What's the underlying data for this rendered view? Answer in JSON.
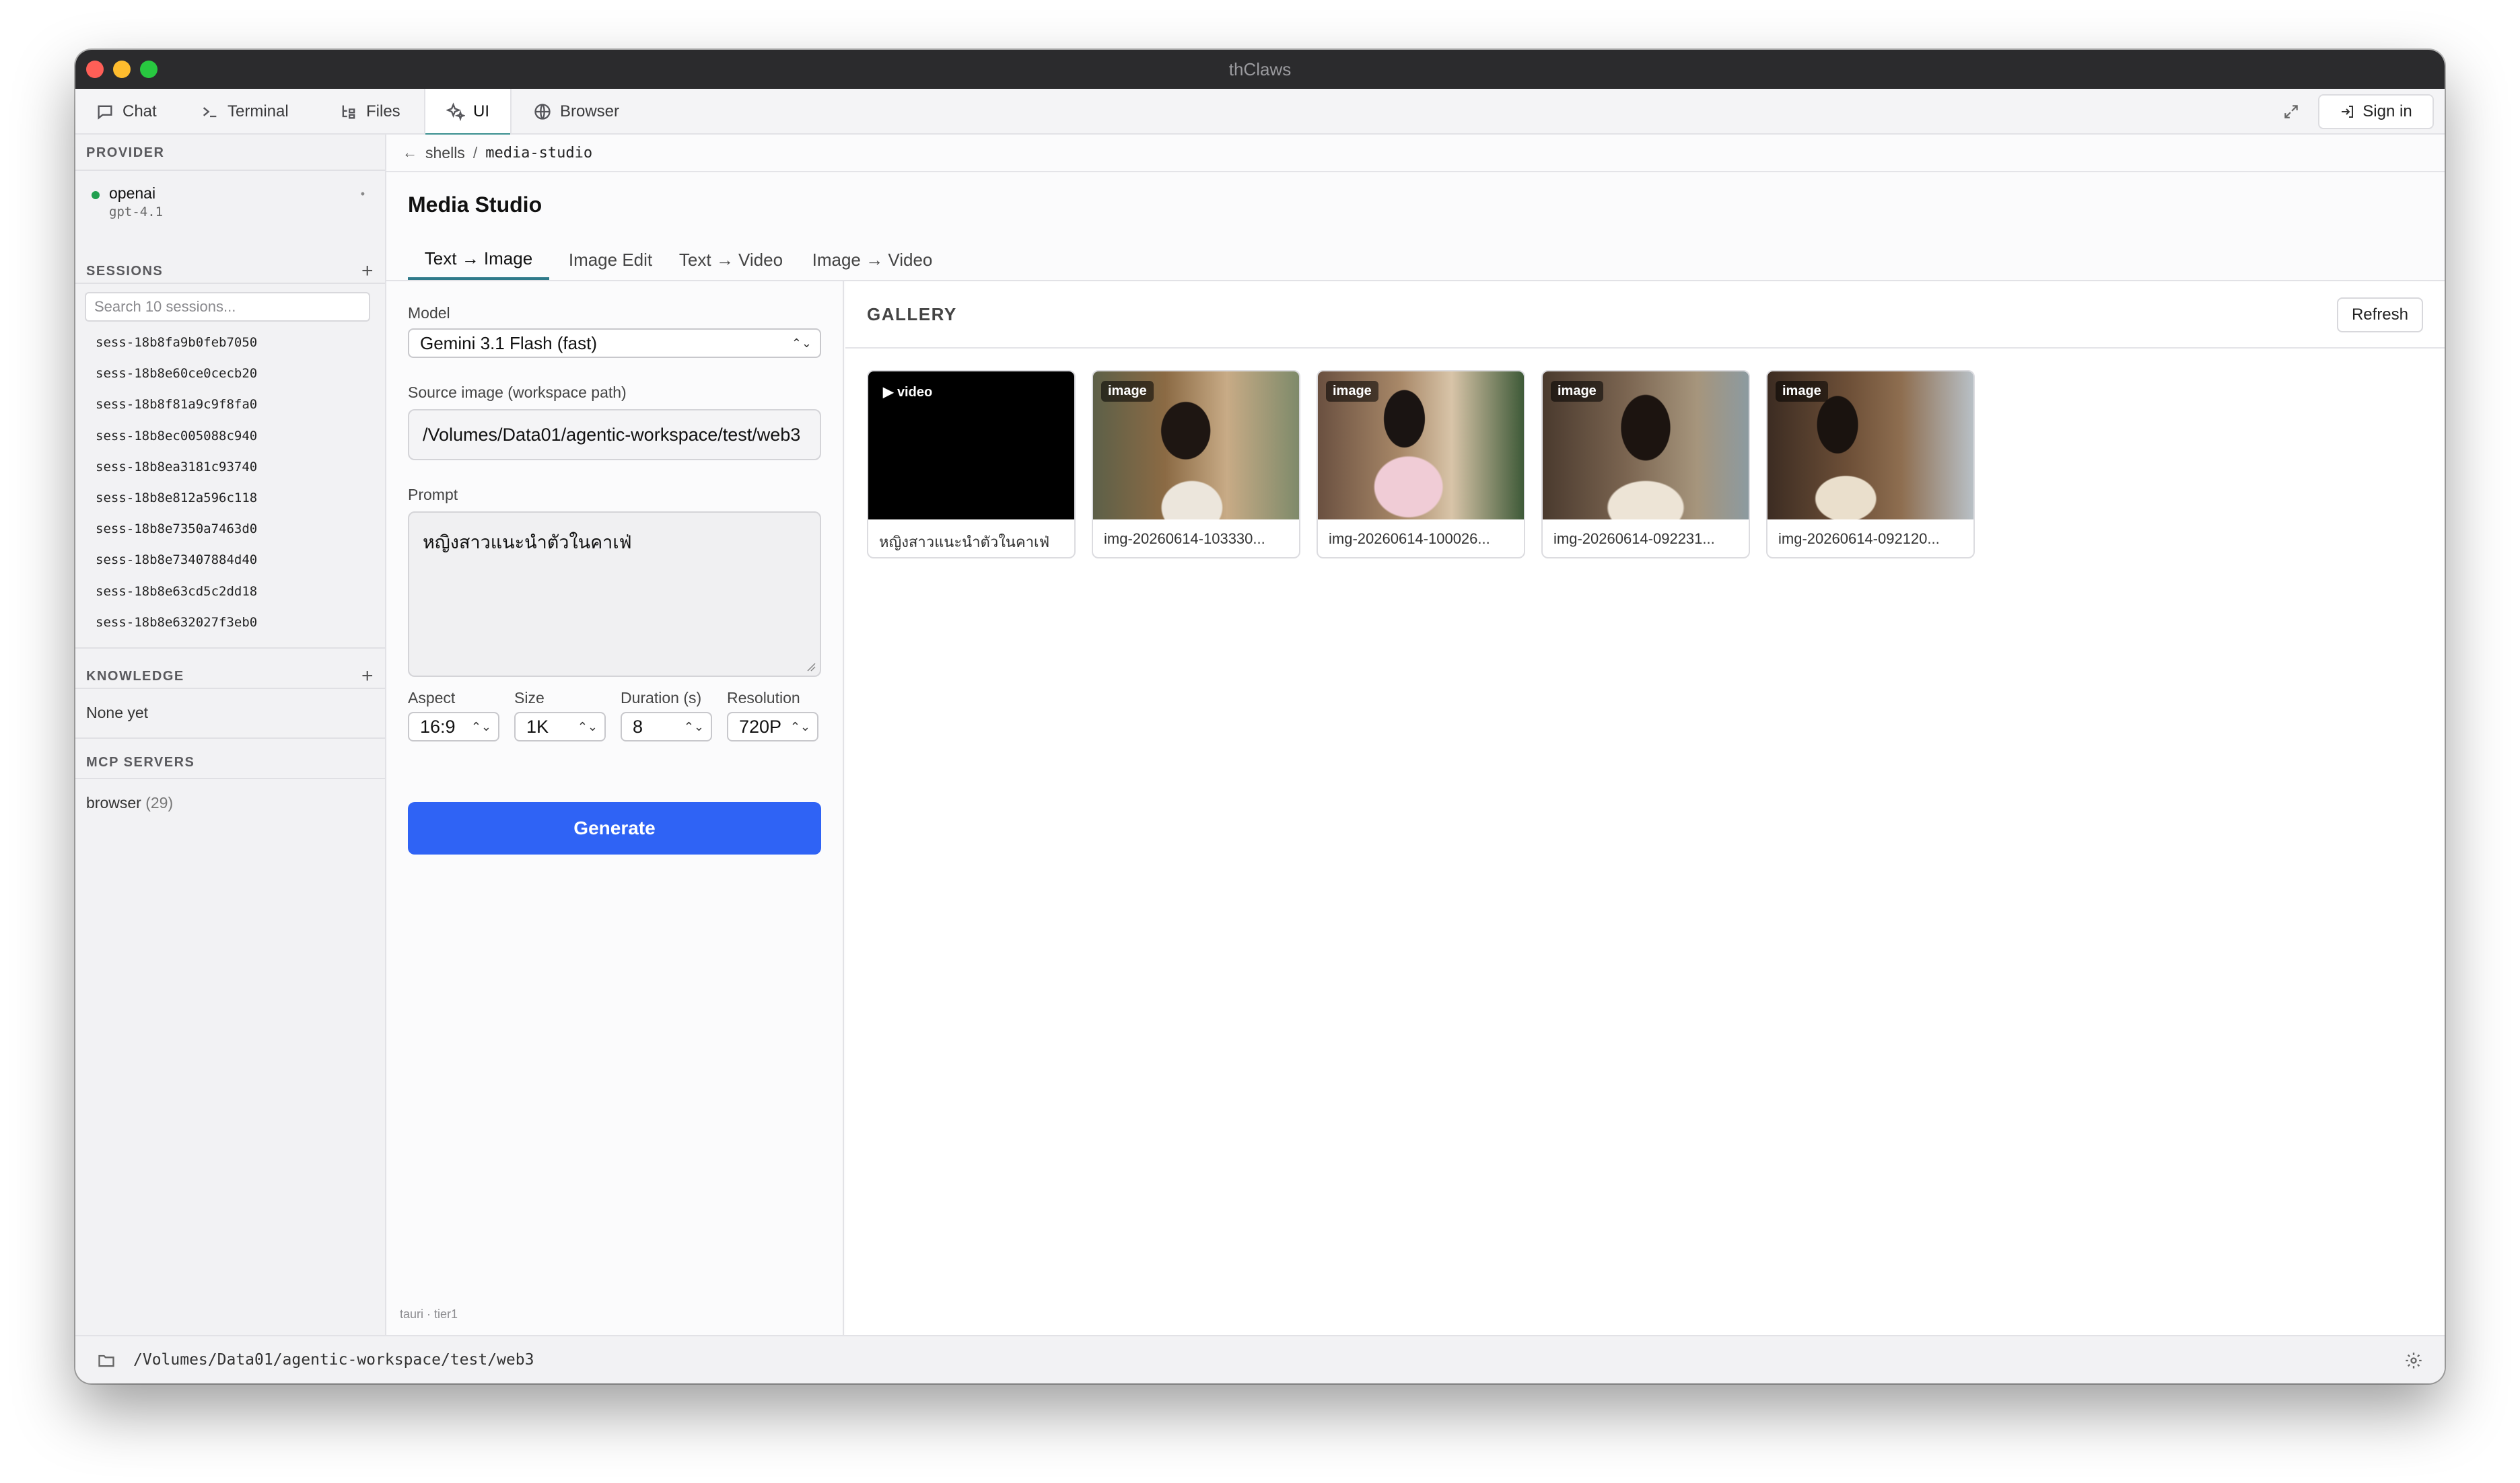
{
  "window": {
    "title": "thClaws"
  },
  "tabs": [
    {
      "label": "Chat",
      "icon": "chat-bubble-icon"
    },
    {
      "label": "Terminal",
      "icon": "terminal-prompt-icon"
    },
    {
      "label": "Files",
      "icon": "file-tree-icon"
    },
    {
      "label": "UI",
      "icon": "sparkles-icon",
      "active": true
    },
    {
      "label": "Browser",
      "icon": "globe-icon"
    }
  ],
  "header": {
    "signin_label": "Sign in"
  },
  "sidebar": {
    "provider_heading": "PROVIDER",
    "provider": {
      "name": "openai",
      "model": "gpt-4.1",
      "status_color": "#22a050"
    },
    "sessions_heading": "SESSIONS",
    "search_placeholder": "Search 10 sessions...",
    "sessions": [
      "sess-18b8fa9b0feb7050",
      "sess-18b8e60ce0cecb20",
      "sess-18b8f81a9c9f8fa0",
      "sess-18b8ec005088c940",
      "sess-18b8ea3181c93740",
      "sess-18b8e812a596c118",
      "sess-18b8e7350a7463d0",
      "sess-18b8e73407884d40",
      "sess-18b8e63cd5c2dd18",
      "sess-18b8e632027f3eb0"
    ],
    "knowledge_heading": "KNOWLEDGE",
    "knowledge_empty": "None yet",
    "mcp_heading": "MCP SERVERS",
    "mcp_server_name": "browser",
    "mcp_server_count": "(29)"
  },
  "breadcrumb": {
    "parent": "shells",
    "separator": "/",
    "current": "media-studio"
  },
  "main": {
    "title": "Media Studio",
    "tabs": [
      "Text → Image",
      "Image Edit",
      "Text → Video",
      "Image → Video"
    ],
    "active_tab": 0
  },
  "form": {
    "model_label": "Model",
    "model_value": "Gemini 3.1 Flash (fast)",
    "source_label": "Source image (workspace path)",
    "source_value": "/Volumes/Data01/agentic-workspace/test/web3",
    "prompt_label": "Prompt",
    "prompt_value": "หญิงสาวแนะนำตัวในคาเฟ่",
    "aspect_label": "Aspect",
    "aspect_value": "16:9",
    "size_label": "Size",
    "size_value": "1K",
    "duration_label": "Duration (s)",
    "duration_value": "8",
    "resolution_label": "Resolution",
    "resolution_value": "720P",
    "generate_label": "Generate",
    "footer_note": "tauri · tier1",
    "accent_color": "#2f63f5"
  },
  "gallery": {
    "title": "GALLERY",
    "refresh_label": "Refresh",
    "items": [
      {
        "badge": "▶ video",
        "caption": "หญิงสาวแนะนำตัวในคาเฟ่"
      },
      {
        "badge": "image",
        "caption": "img-20260614-103330..."
      },
      {
        "badge": "image",
        "caption": "img-20260614-100026..."
      },
      {
        "badge": "image",
        "caption": "img-20260614-092231..."
      },
      {
        "badge": "image",
        "caption": "img-20260614-092120..."
      }
    ]
  },
  "statusbar": {
    "path": "/Volumes/Data01/agentic-workspace/test/web3"
  }
}
